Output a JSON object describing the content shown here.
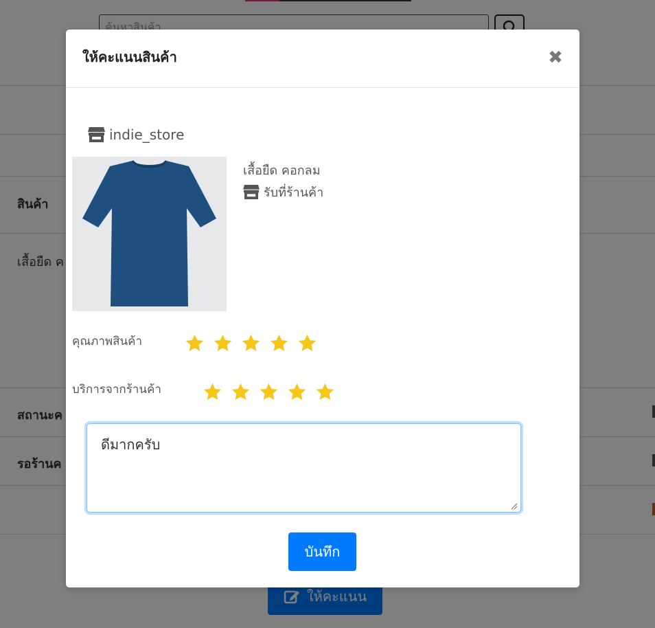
{
  "background": {
    "search_placeholder": "ค้นหาสินค้า",
    "row_labels": [
      "สินค้า",
      "เสื้อยืด ค",
      "สถานะค",
      "รอร้านค"
    ],
    "rate_button_label": "ให้คะแนน"
  },
  "modal": {
    "title": "ให้คะแนนสินค้า",
    "close_symbol": "✖",
    "store_name": "indie_store",
    "product_name": "เสื้อยืด คอกลม",
    "pickup_label": "รับที่ร้านค้า",
    "ratings": [
      {
        "label": "คุณภาพสินค้า",
        "stars": 5,
        "max": 5
      },
      {
        "label": "บริการจากร้านค้า",
        "stars": 5,
        "max": 5
      }
    ],
    "review_text": "ดีมากครับ",
    "save_label": "บันทึก"
  },
  "colors": {
    "primary": "#007bff",
    "star": "#f5c518",
    "overlay": "rgba(0,0,0,0.5)"
  },
  "icons": [
    "store-icon",
    "close-icon",
    "star-icon",
    "search-icon",
    "edit-icon",
    "tshirt-image"
  ]
}
